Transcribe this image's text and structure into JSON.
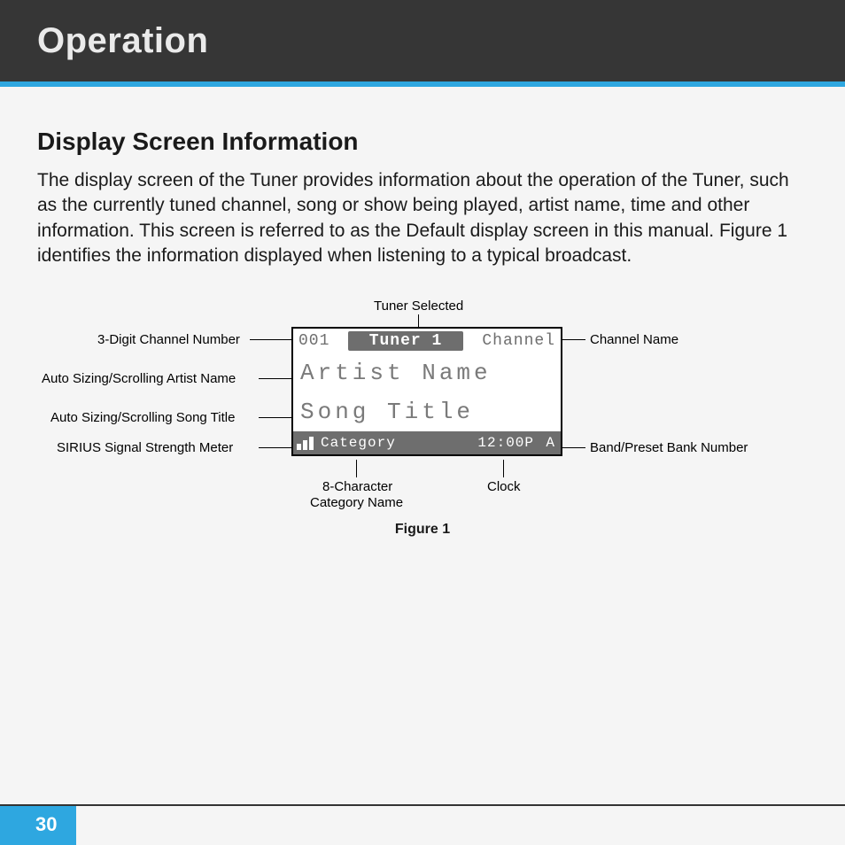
{
  "header": {
    "title": "Operation"
  },
  "section": {
    "heading": "Display Screen Information",
    "intro": "The display screen of the Tuner provides information about the operation of the Tuner, such as the currently tuned channel, song or show being played, artist name, time and other information. This screen is referred to as the Default display screen in this manual. Figure 1 identifies the information displayed when listening to a typical broadcast."
  },
  "figure": {
    "caption": "Figure 1",
    "callouts": {
      "tuner_selected": "Tuner Selected",
      "channel_number": "3-Digit Channel Number",
      "artist_name": "Auto Sizing/Scrolling Artist Name",
      "song_title": "Auto Sizing/Scrolling Song Title",
      "signal_meter": "SIRIUS Signal Strength Meter",
      "channel_name": "Channel Name",
      "band_preset": "Band/Preset Bank Number",
      "category_name_line1": "8-Character",
      "category_name_line2": "Category Name",
      "clock": "Clock"
    },
    "lcd": {
      "channel_number": "001",
      "tuner_selected": "Tuner 1",
      "channel_name": "Channel",
      "artist": "Artist Name",
      "song": "Song Title",
      "category": "Category",
      "clock": "12:00P",
      "bank": "A"
    }
  },
  "footer": {
    "page_number": "30"
  }
}
